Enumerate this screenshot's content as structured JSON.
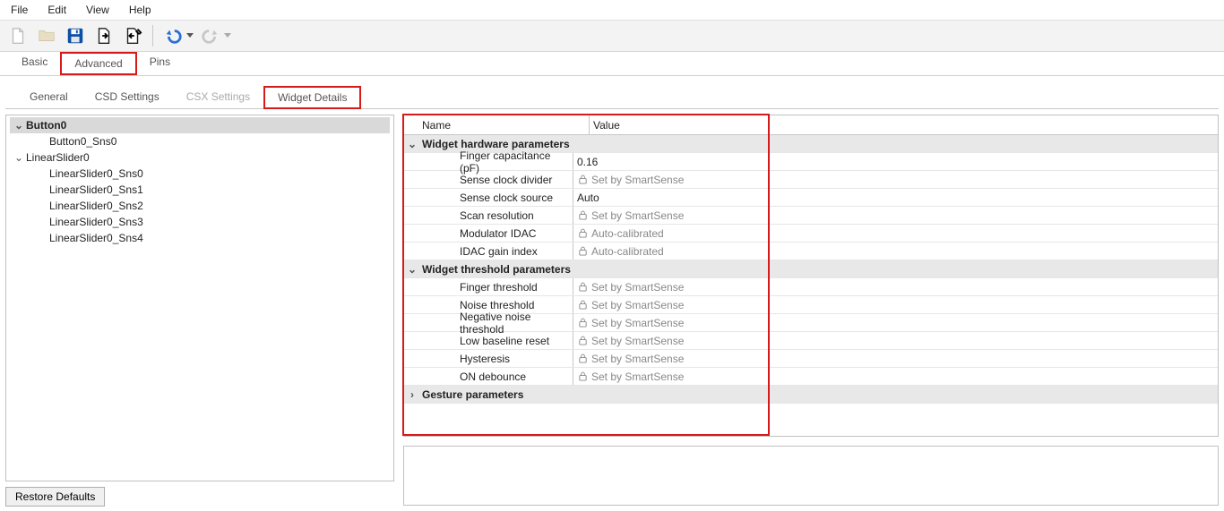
{
  "menu": {
    "file": "File",
    "edit": "Edit",
    "view": "View",
    "help": "Help"
  },
  "toolbar_icons": {
    "new": "new-file-icon",
    "open": "open-folder-icon",
    "save": "save-icon",
    "import": "import-icon",
    "export": "export-icon",
    "undo": "undo-icon",
    "redo": "redo-icon"
  },
  "outer_tabs": {
    "basic": "Basic",
    "advanced": "Advanced",
    "pins": "Pins"
  },
  "inner_tabs": {
    "general": "General",
    "csd": "CSD Settings",
    "csx": "CSX Settings",
    "widget": "Widget Details"
  },
  "tree": [
    {
      "label": "Button0",
      "expanded": true,
      "selected": true,
      "children": [
        {
          "label": "Button0_Sns0"
        }
      ]
    },
    {
      "label": "LinearSlider0",
      "expanded": true,
      "children": [
        {
          "label": "LinearSlider0_Sns0"
        },
        {
          "label": "LinearSlider0_Sns1"
        },
        {
          "label": "LinearSlider0_Sns2"
        },
        {
          "label": "LinearSlider0_Sns3"
        },
        {
          "label": "LinearSlider0_Sns4"
        }
      ]
    }
  ],
  "grid": {
    "headers": {
      "name": "Name",
      "value": "Value"
    },
    "groups": [
      {
        "title": "Widget hardware parameters",
        "expanded": true,
        "rows": [
          {
            "name": "Finger capacitance (pF)",
            "value": "0.16",
            "locked": false
          },
          {
            "name": "Sense clock divider",
            "value": "Set by SmartSense",
            "locked": true
          },
          {
            "name": "Sense clock source",
            "value": "Auto",
            "locked": false
          },
          {
            "name": "Scan resolution",
            "value": "Set by SmartSense",
            "locked": true
          },
          {
            "name": "Modulator IDAC",
            "value": "Auto-calibrated",
            "locked": true
          },
          {
            "name": "IDAC gain index",
            "value": "Auto-calibrated",
            "locked": true
          }
        ]
      },
      {
        "title": "Widget threshold parameters",
        "expanded": true,
        "rows": [
          {
            "name": "Finger threshold",
            "value": "Set by SmartSense",
            "locked": true
          },
          {
            "name": "Noise threshold",
            "value": "Set by SmartSense",
            "locked": true
          },
          {
            "name": "Negative noise threshold",
            "value": "Set by SmartSense",
            "locked": true
          },
          {
            "name": "Low baseline reset",
            "value": "Set by SmartSense",
            "locked": true
          },
          {
            "name": "Hysteresis",
            "value": "Set by SmartSense",
            "locked": true
          },
          {
            "name": "ON debounce",
            "value": "Set by SmartSense",
            "locked": true
          }
        ]
      },
      {
        "title": "Gesture parameters",
        "expanded": false,
        "rows": []
      }
    ]
  },
  "buttons": {
    "restore": "Restore Defaults"
  }
}
